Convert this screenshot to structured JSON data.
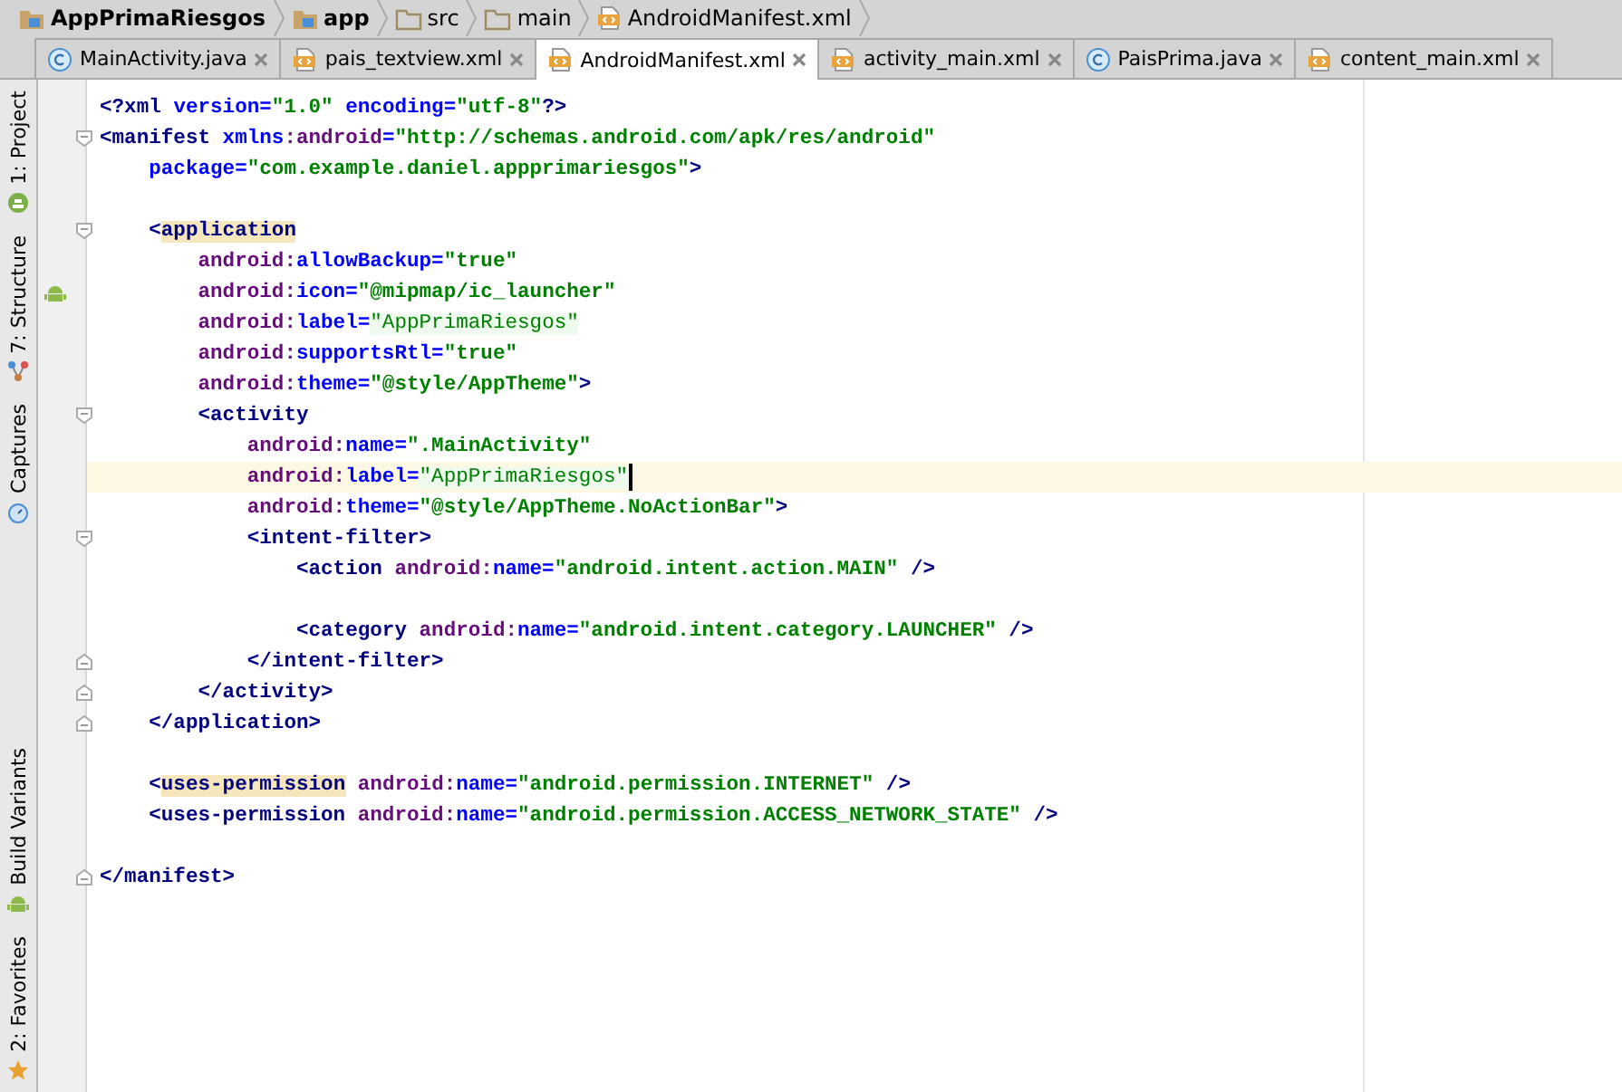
{
  "breadcrumb": [
    {
      "label": "AppPrimaRiesgos",
      "kind": "module"
    },
    {
      "label": "app",
      "kind": "module"
    },
    {
      "label": "src",
      "kind": "folder"
    },
    {
      "label": "main",
      "kind": "folder"
    },
    {
      "label": "AndroidManifest.xml",
      "kind": "xml"
    }
  ],
  "tabs": [
    {
      "label": "MainActivity.java",
      "kind": "java",
      "selected": false
    },
    {
      "label": "pais_textview.xml",
      "kind": "xml",
      "selected": false
    },
    {
      "label": "AndroidManifest.xml",
      "kind": "xml",
      "selected": true
    },
    {
      "label": "activity_main.xml",
      "kind": "xml",
      "selected": false
    },
    {
      "label": "PaisPrima.java",
      "kind": "java",
      "selected": false
    },
    {
      "label": "content_main.xml",
      "kind": "xml",
      "selected": false
    }
  ],
  "tool_strip_top": [
    {
      "label": "1: Project",
      "kind": "project"
    },
    {
      "label": "7: Structure",
      "kind": "structure"
    },
    {
      "label": "Captures",
      "kind": "captures"
    }
  ],
  "tool_strip_bottom": [
    {
      "label": "Build Variants",
      "kind": "android"
    },
    {
      "label": "2: Favorites",
      "kind": "star"
    }
  ],
  "lines": [
    {
      "tokens": [
        {
          "kind": "tag",
          "text": "<?xml "
        },
        {
          "kind": "attr",
          "text": "version="
        },
        {
          "kind": "value",
          "text": "\"1.0\""
        },
        {
          "kind": "attr",
          "text": " encoding="
        },
        {
          "kind": "value",
          "text": "\"utf-8\""
        },
        {
          "kind": "tag",
          "text": "?>"
        }
      ]
    },
    {
      "fold_start": true,
      "tokens": [
        {
          "kind": "tag",
          "text": "<manifest "
        },
        {
          "kind": "attr",
          "text": "xmlns"
        },
        {
          "kind": "ns",
          "text": ":android"
        },
        {
          "kind": "attr",
          "text": "="
        },
        {
          "kind": "value",
          "text": "\"http://schemas.android.com/apk/res/android\""
        }
      ]
    },
    {
      "tokens": [
        {
          "kind": "attr",
          "text": "    package="
        },
        {
          "kind": "value",
          "text": "\"com.example.daniel.appprimariesgos\""
        },
        {
          "kind": "tag",
          "text": ">"
        }
      ]
    },
    {
      "blank_before": true,
      "fold_start": true,
      "tokens": [
        {
          "kind": "tag",
          "text": "    <"
        },
        {
          "kind": "tag",
          "text": "application",
          "highlight": true
        }
      ]
    },
    {
      "tokens": [
        {
          "kind": "ns",
          "text": "        android:"
        },
        {
          "kind": "attr",
          "text": "allowBackup="
        },
        {
          "kind": "value",
          "text": "\"true\""
        }
      ]
    },
    {
      "gutter_icon": true,
      "tokens": [
        {
          "kind": "ns",
          "text": "        android:"
        },
        {
          "kind": "attr",
          "text": "icon="
        },
        {
          "kind": "value",
          "text": "\"@mipmap/ic_launcher\""
        }
      ]
    },
    {
      "tokens": [
        {
          "kind": "ns",
          "text": "        android:"
        },
        {
          "kind": "attr",
          "text": "label="
        },
        {
          "kind": "literal",
          "text": "\"AppPrimaRiesgos\"",
          "highlight": true
        }
      ]
    },
    {
      "tokens": [
        {
          "kind": "ns",
          "text": "        android:"
        },
        {
          "kind": "attr",
          "text": "supportsRtl="
        },
        {
          "kind": "value",
          "text": "\"true\""
        }
      ]
    },
    {
      "tokens": [
        {
          "kind": "ns",
          "text": "        android:"
        },
        {
          "kind": "attr",
          "text": "theme="
        },
        {
          "kind": "value",
          "text": "\"@style/AppTheme\""
        },
        {
          "kind": "tag",
          "text": ">"
        }
      ]
    },
    {
      "fold_start": true,
      "tokens": [
        {
          "kind": "tag",
          "text": "        <activity"
        }
      ]
    },
    {
      "tokens": [
        {
          "kind": "ns",
          "text": "            android:"
        },
        {
          "kind": "attr",
          "text": "name="
        },
        {
          "kind": "value",
          "text": "\".MainActivity\""
        }
      ]
    },
    {
      "current": true,
      "caret": true,
      "tokens": [
        {
          "kind": "ns",
          "text": "            android:"
        },
        {
          "kind": "attr",
          "text": "label="
        },
        {
          "kind": "literal",
          "text": "\"AppPrimaRiesgos\"",
          "highlight": true
        }
      ]
    },
    {
      "tokens": [
        {
          "kind": "ns",
          "text": "            android:"
        },
        {
          "kind": "attr",
          "text": "theme="
        },
        {
          "kind": "value",
          "text": "\"@style/AppTheme.NoActionBar\""
        },
        {
          "kind": "tag",
          "text": ">"
        }
      ]
    },
    {
      "fold_start": true,
      "tokens": [
        {
          "kind": "tag",
          "text": "            <intent-filter>"
        }
      ]
    },
    {
      "tokens": [
        {
          "kind": "tag",
          "text": "                <action "
        },
        {
          "kind": "ns",
          "text": "android:"
        },
        {
          "kind": "attr",
          "text": "name="
        },
        {
          "kind": "value",
          "text": "\"android.intent.action.MAIN\""
        },
        {
          "kind": "tag",
          "text": " />"
        }
      ]
    },
    {
      "blank_before": true,
      "tokens": [
        {
          "kind": "tag",
          "text": "                <category "
        },
        {
          "kind": "ns",
          "text": "android:"
        },
        {
          "kind": "attr",
          "text": "name="
        },
        {
          "kind": "value",
          "text": "\"android.intent.category.LAUNCHER\""
        },
        {
          "kind": "tag",
          "text": " />"
        }
      ]
    },
    {
      "fold_end": true,
      "tokens": [
        {
          "kind": "tag",
          "text": "            </intent-filter>"
        }
      ]
    },
    {
      "fold_end": true,
      "tokens": [
        {
          "kind": "tag",
          "text": "        </activity>"
        }
      ]
    },
    {
      "fold_end": true,
      "tokens": [
        {
          "kind": "tag",
          "text": "    </application>"
        }
      ]
    },
    {
      "blank_before": true,
      "tokens": [
        {
          "kind": "tag",
          "text": "    <"
        },
        {
          "kind": "tag",
          "text": "uses-permission",
          "highlight": true
        },
        {
          "kind": "ns",
          "text": " android:"
        },
        {
          "kind": "attr",
          "text": "name="
        },
        {
          "kind": "value",
          "text": "\"android.permission.INTERNET\""
        },
        {
          "kind": "tag",
          "text": " />"
        }
      ]
    },
    {
      "tokens": [
        {
          "kind": "tag",
          "text": "    <uses-permission "
        },
        {
          "kind": "ns",
          "text": "android:"
        },
        {
          "kind": "attr",
          "text": "name="
        },
        {
          "kind": "value",
          "text": "\"android.permission.ACCESS_NETWORK_STATE\""
        },
        {
          "kind": "tag",
          "text": " />"
        }
      ]
    },
    {
      "blank_before": true,
      "fold_end": true,
      "tokens": [
        {
          "kind": "tag",
          "text": "</manifest>"
        }
      ]
    }
  ]
}
